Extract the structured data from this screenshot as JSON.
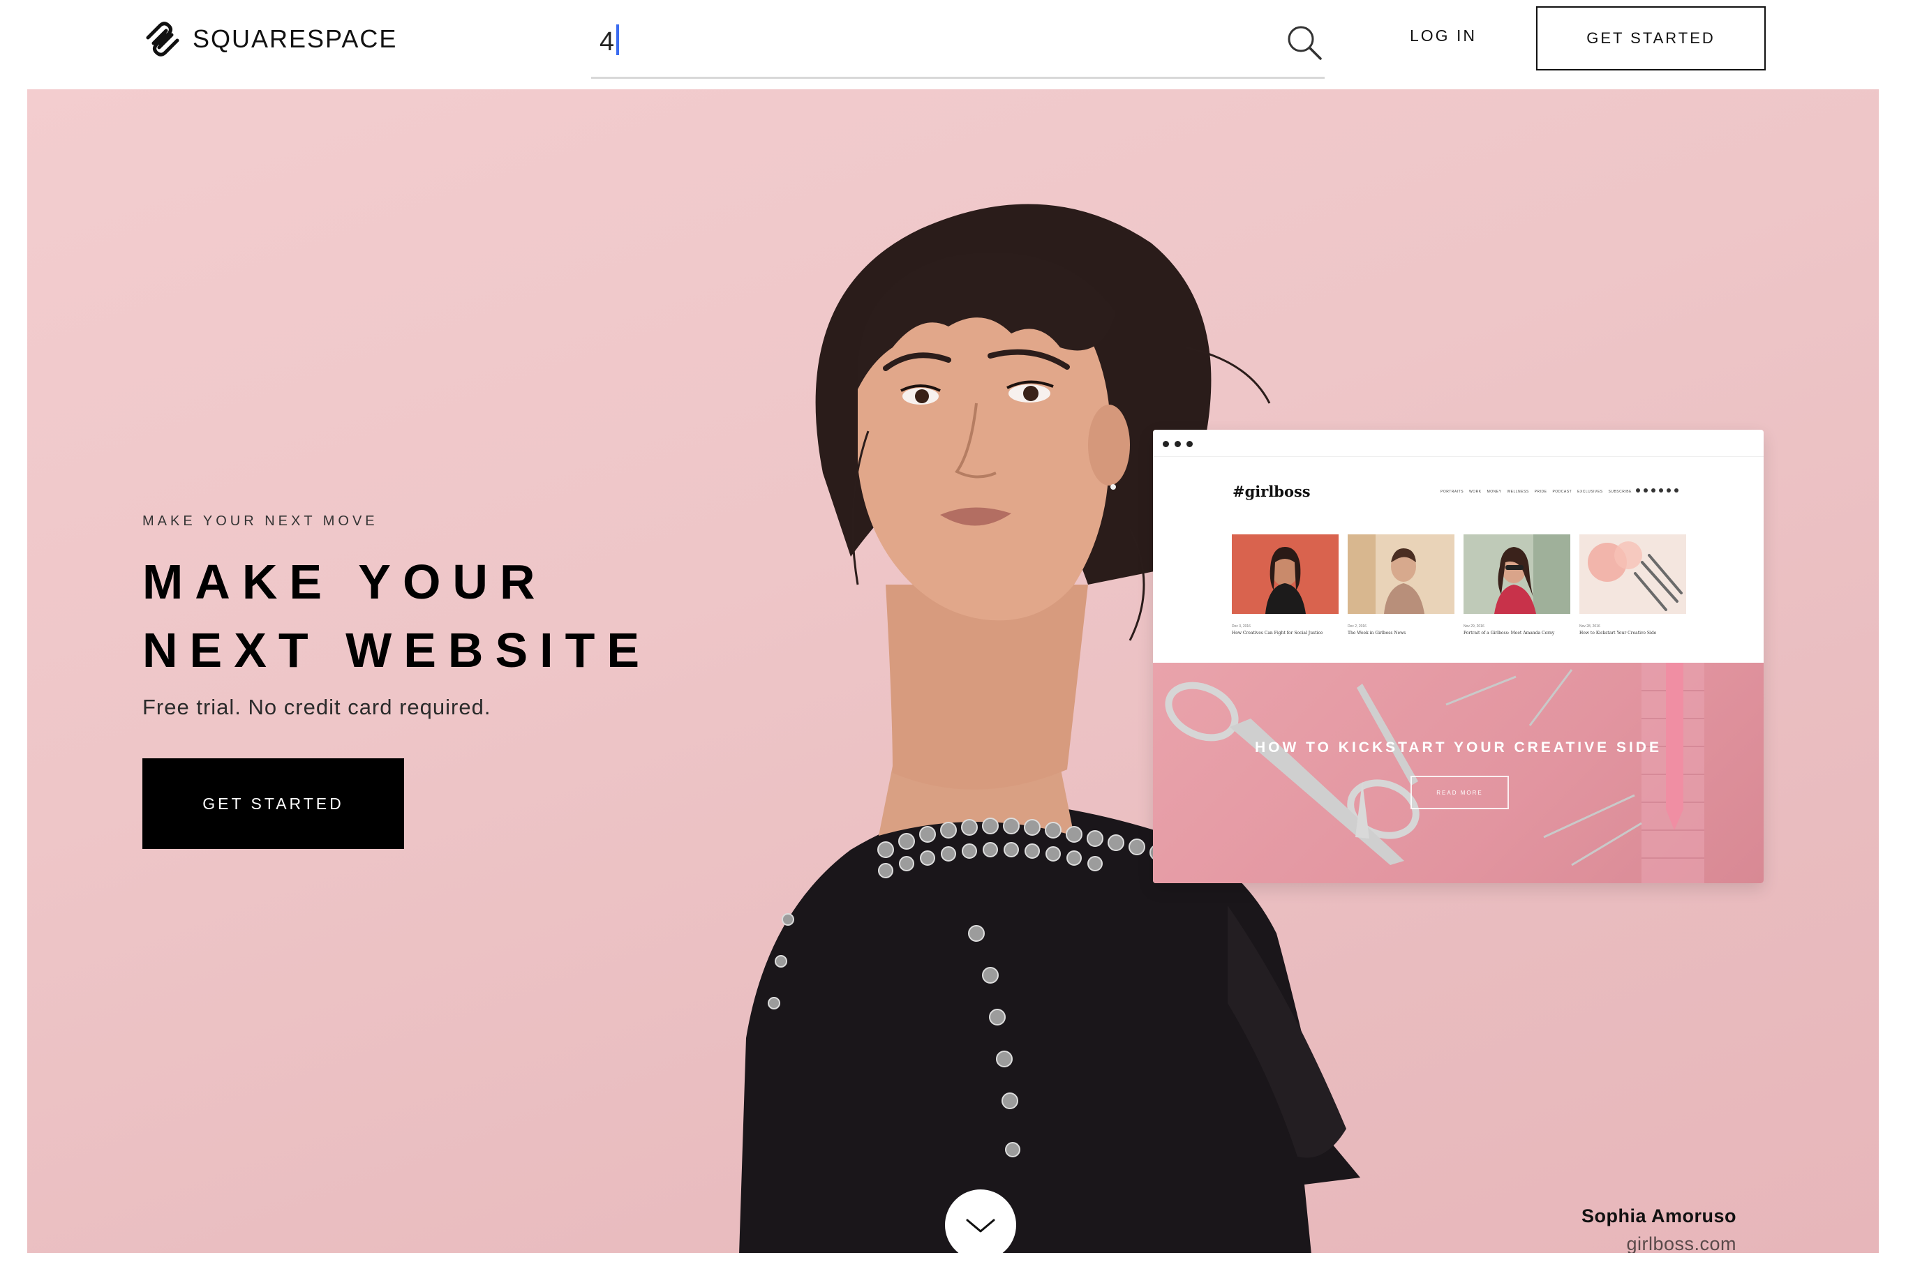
{
  "header": {
    "brand": "SQUARESPACE",
    "search_value": "4",
    "login_label": "LOG IN",
    "cta_label": "GET STARTED"
  },
  "hero": {
    "eyebrow": "MAKE YOUR NEXT MOVE",
    "headline_line1": "MAKE YOUR",
    "headline_line2": "NEXT WEBSITE",
    "subtitle": "Free trial. No credit card required.",
    "cta_label": "GET STARTED",
    "attribution_name": "Sophia Amoruso",
    "attribution_site": "girlboss.com"
  },
  "preview": {
    "site_logo": "#girlboss",
    "nav": [
      "PORTRAITS",
      "WORK",
      "MONEY",
      "WELLNESS",
      "PRIDE",
      "PODCAST",
      "EXCLUSIVES",
      "SUBSCRIBE"
    ],
    "posts": [
      {
        "date": "Dec 3, 2016",
        "caption": "How Creatives Can Fight for Social Justice"
      },
      {
        "date": "Dec 2, 2016",
        "caption": "The Week in Girlboss News"
      },
      {
        "date": "Nov 29, 2016",
        "caption": "Portrait of a Girlboss: Meet Amanda Cerny"
      },
      {
        "date": "Nov 28, 2016",
        "caption": "How to Kickstart Your Creative Side"
      }
    ],
    "feature_title": "HOW TO KICKSTART YOUR CREATIVE SIDE",
    "feature_button": "READ MORE"
  },
  "colors": {
    "hero_bg": "#efc4c6",
    "caret": "#3b6cf0",
    "button_dark": "#000000"
  },
  "icons": {
    "logo": "squarespace-logo-icon",
    "search": "search-icon",
    "scroll": "chevron-down-icon"
  }
}
